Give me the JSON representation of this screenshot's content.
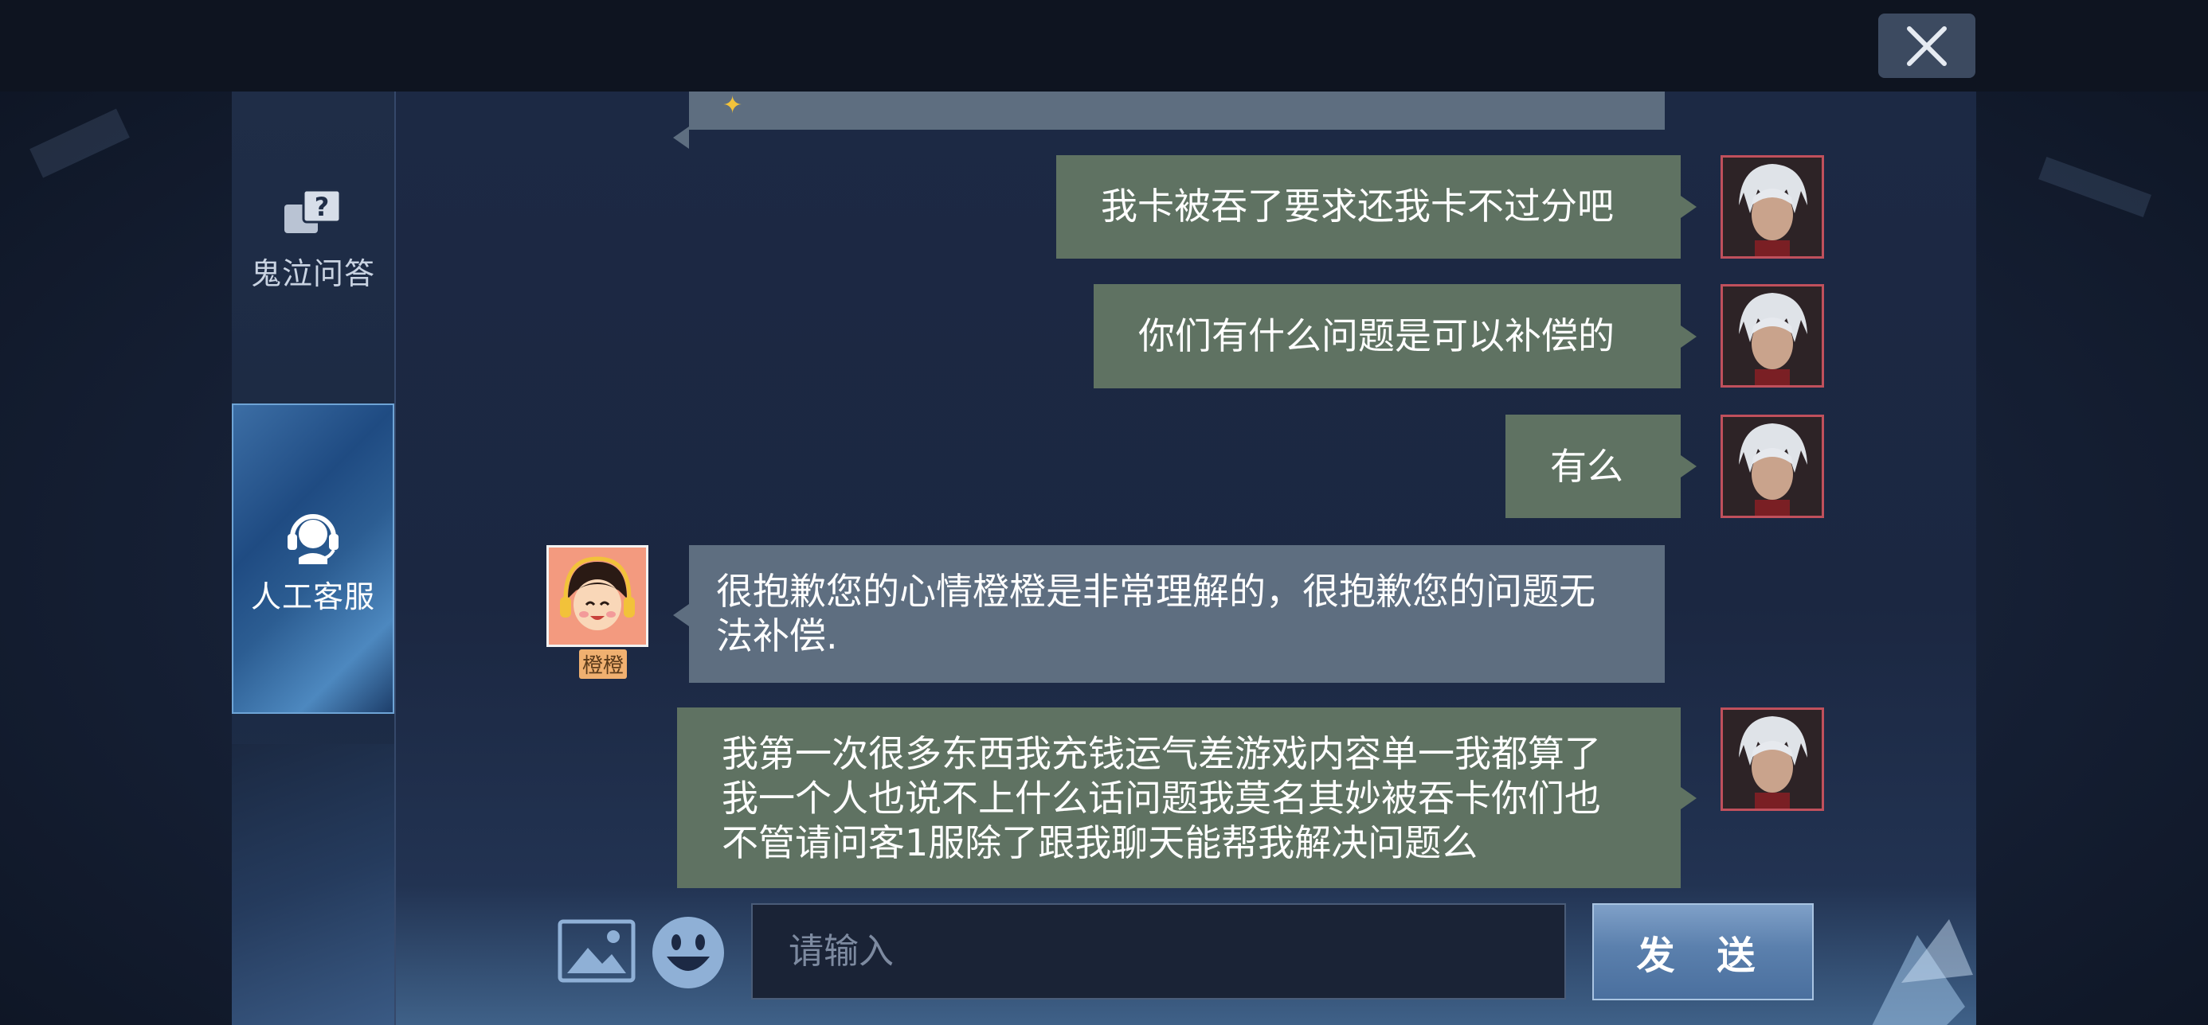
{
  "sidebar": {
    "items": [
      {
        "label": "鬼泣问答",
        "icon": "qa-icon"
      },
      {
        "label": "人工客服",
        "icon": "headset-icon"
      }
    ]
  },
  "messages": [
    {
      "sender": "me",
      "text": "我卡被吞了要求还我卡不过分吧"
    },
    {
      "sender": "me",
      "text": "你们有什么问题是可以补偿的"
    },
    {
      "sender": "me",
      "text": "有么"
    },
    {
      "sender": "cs",
      "name": "橙橙",
      "text": "很抱歉您的心情橙橙是非常理解的，很抱歉您的问题无法补偿."
    },
    {
      "sender": "me",
      "text": "我第一次很多东西我充钱运气差游戏内容单一我都算了我一个人也说不上什么话问题我莫名其妙被吞卡你们也不管请问客1服除了跟我聊天能帮我解决问题么"
    }
  ],
  "input": {
    "placeholder": "请输入",
    "value": ""
  },
  "send_label": "发 送",
  "colors": {
    "my_bubble": "#5f7262",
    "cs_bubble": "#5e6e80",
    "send_button": "#5b80ad"
  }
}
